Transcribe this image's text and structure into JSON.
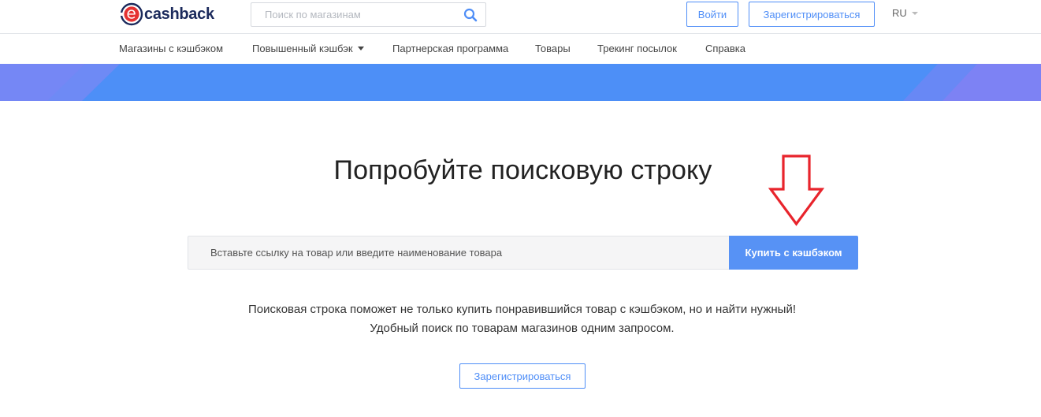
{
  "header": {
    "logo_text": "cashback",
    "search_placeholder": "Поиск по магазинам",
    "login_label": "Войти",
    "register_label": "Зарегистрироваться",
    "language": "RU"
  },
  "nav": {
    "items": [
      {
        "label": "Магазины с кэшбэком"
      },
      {
        "label": "Повышенный кэшбэк"
      },
      {
        "label": "Партнерская программа"
      },
      {
        "label": "Товары"
      },
      {
        "label": "Трекинг посылок"
      },
      {
        "label": "Справка"
      }
    ]
  },
  "main": {
    "headline": "Попробуйте поисковую строку",
    "search_placeholder": "Вставьте ссылку на товар или введите наименование товара",
    "buy_button": "Купить с кэшбэком",
    "description_line1": "Поисковая строка поможет не только купить понравившийся товар с кэшбэком, но и найти нужный!",
    "description_line2": "Удобный поиск по товарам магазинов одним запросом.",
    "register_button": "Зарегистрироваться"
  },
  "icons": {
    "logo": "letter-e-circle-logo-icon",
    "search": "search-icon",
    "language_caret": "chevron-down-icon",
    "nav_caret": "chevron-down-icon",
    "annotation": "red-down-arrow-icon"
  },
  "colors": {
    "accent": "#4f8ef7",
    "primary_button": "#5792f5",
    "banner": "#4d8ff7",
    "logo_red": "#e53232",
    "logo_navy": "#1b2a5c",
    "annotation_arrow": "#e8242c"
  }
}
